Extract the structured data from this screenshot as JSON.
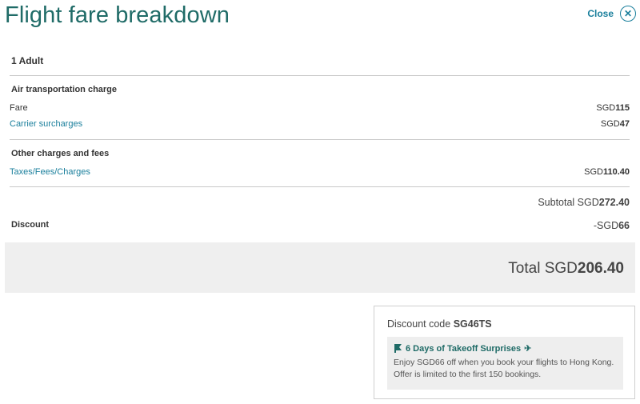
{
  "header": {
    "title": "Flight fare breakdown",
    "close_label": "Close",
    "close_icon": "close-icon"
  },
  "passenger": "1 Adult",
  "air_section": {
    "heading": "Air transportation charge",
    "rows": [
      {
        "label": "Fare",
        "currency": "SGD",
        "amount": "115"
      },
      {
        "label": "Carrier surcharges",
        "currency": "SGD",
        "amount": "47"
      }
    ]
  },
  "other_section": {
    "heading": "Other charges and fees",
    "rows": [
      {
        "label": "Taxes/Fees/Charges",
        "currency": "SGD",
        "amount": "110.40"
      }
    ]
  },
  "subtotal": {
    "label": "Subtotal SGD",
    "amount": "272.40"
  },
  "discount": {
    "label": "Discount",
    "prefix": "-SGD",
    "amount": "66"
  },
  "total": {
    "label": "Total SGD",
    "amount": "206.40"
  },
  "promo": {
    "code_label": "Discount code",
    "code": "SG46TS",
    "title": "6 Days of Takeoff Surprises",
    "description": "Enjoy SGD66 off when you book your flights to Hong Kong. Offer is limited to the first 150 bookings.",
    "accent_color": "#1f6b67"
  }
}
